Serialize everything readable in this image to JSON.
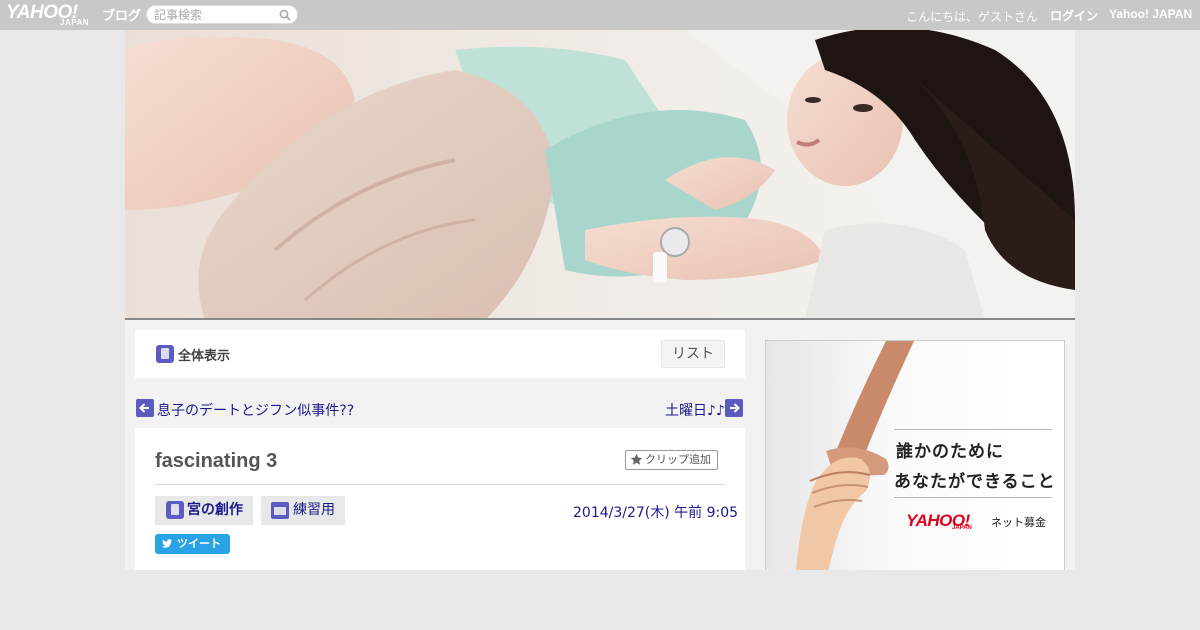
{
  "topbar": {
    "logo_text": "YAHOO!",
    "logo_sub": "JAPAN",
    "blog_label": "ブログ",
    "search_placeholder": "記事検索",
    "greeting": "こんにちは、ゲストさん",
    "login": "ログイン",
    "yahoo_japan": "Yahoo! JAPAN"
  },
  "viewbar": {
    "all_label": "全体表示",
    "list_button": "リスト"
  },
  "nav": {
    "prev_title": "息子のデートとジフン似事件??",
    "next_title": "土曜日♪♪"
  },
  "article": {
    "title": "fascinating 3",
    "clip_button": "クリップ追加",
    "categories": [
      "宮の創作",
      "練習用"
    ],
    "date": "2014/3/27(木) 午前 9:05",
    "tweet_button": "ツイート"
  },
  "ad": {
    "line1": "誰かのために",
    "line2": "あなたができること",
    "logo": "YAHOO!",
    "logo_sub": "JAPAN",
    "tagline": "ネット募金"
  },
  "colors": {
    "topbar": "#c8c8c8",
    "link": "#1a1a8c",
    "accent_icon": "#5c5cc0",
    "tweet": "#2aa2e6",
    "ad_logo": "#e0001b"
  }
}
